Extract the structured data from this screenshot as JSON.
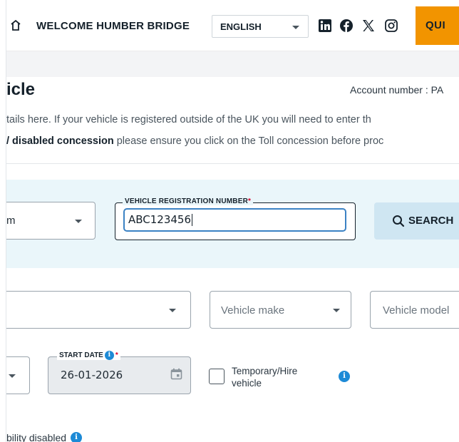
{
  "header": {
    "welcome": "WELCOME HUMBER BRIDGE",
    "language": "ENGLISH",
    "social_icons": [
      "linkedin-icon",
      "facebook-icon",
      "x-icon",
      "instagram-icon"
    ],
    "quick_button": "QUI"
  },
  "page": {
    "title": "icle",
    "account_number": "Account number : PA",
    "intro_line1": "tails here. If your vehicle is registered outside of the UK you will need to enter th",
    "intro_line2_bold": "/ disabled concession",
    "intro_line2_rest": " please ensure you click on the Toll concession before proc"
  },
  "search": {
    "type_value": "m",
    "reg_label": "VEHICLE REGISTRATION NUMBER",
    "required_mark": "*",
    "reg_value": "ABC123456",
    "button_label": "SEARCH"
  },
  "details": {
    "make_placeholder": "Vehicle make",
    "model_placeholder": "Vehicle model"
  },
  "dates": {
    "start_label": "START DATE",
    "required_mark": "*",
    "start_value": "26-01-2026",
    "temporary_label_1": "Temporary/Hire",
    "temporary_label_2": "vehicle"
  },
  "footer": {
    "mobility_label": "bility disabled"
  },
  "colors": {
    "accent_orange": "#f29400",
    "band_blue": "#eaf6fa",
    "info_blue": "#1d8ad6",
    "focus_blue": "#3b82c4",
    "required_red": "#d6002b"
  }
}
